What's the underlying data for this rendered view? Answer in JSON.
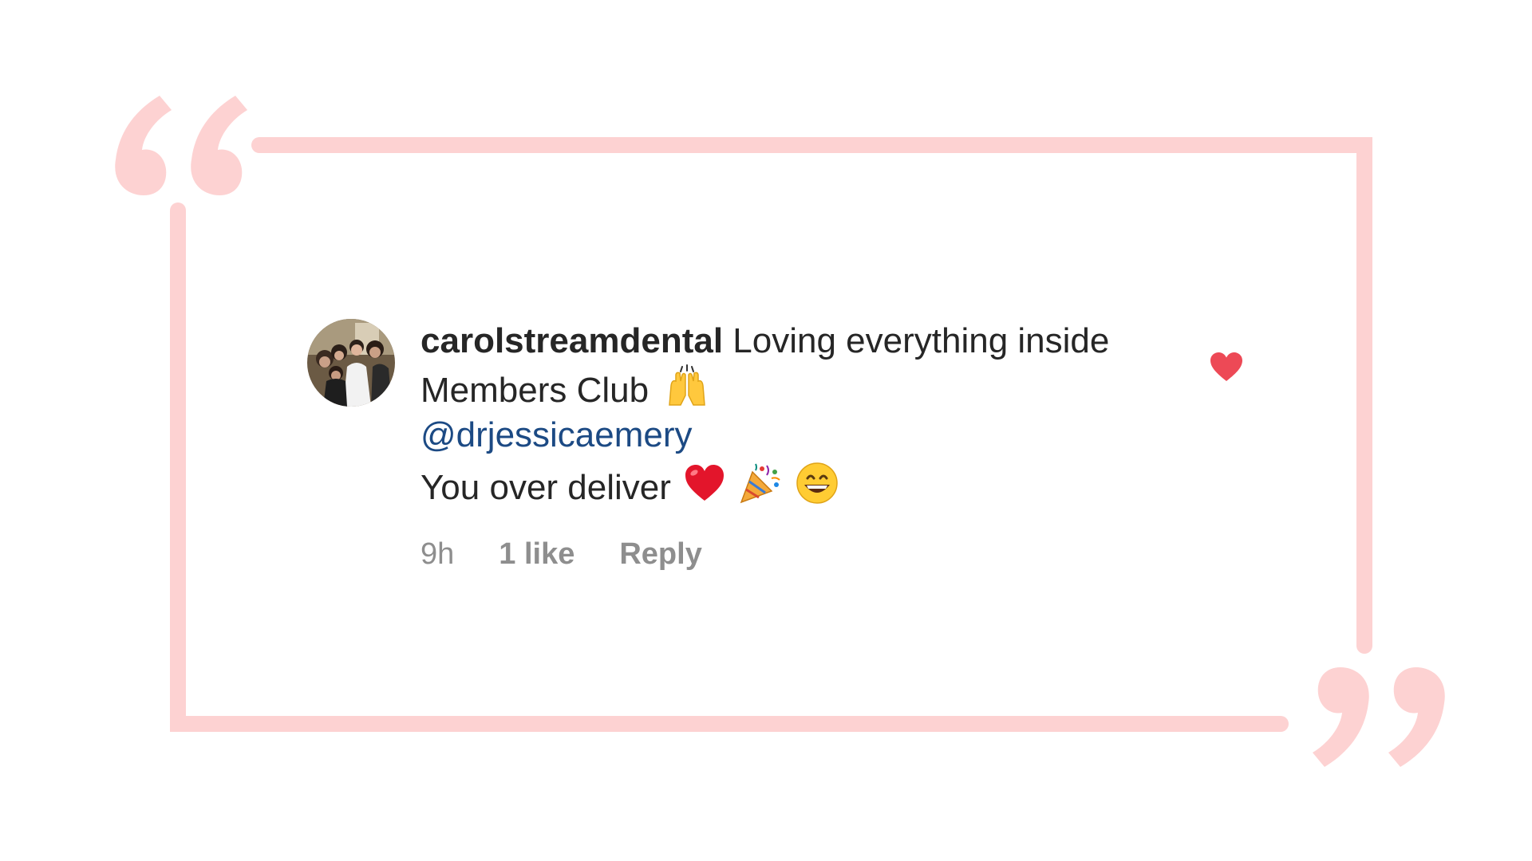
{
  "comment": {
    "username": "carolstreamdental",
    "text_line1": "Loving everything inside Members Club",
    "mention": "@drjessicaemery",
    "text_line2": "You over deliver",
    "time": "9h",
    "likes": "1 like",
    "reply_label": "Reply",
    "liked": true
  },
  "icons": {
    "emoji_after_line1": "raised-hands-icon",
    "emoji_after_line2": [
      "red-heart-icon",
      "party-popper-icon",
      "grinning-face-icon"
    ],
    "like_button": "heart-icon"
  },
  "colors": {
    "frame": "#fdd2d2",
    "like_heart": "#ed4956",
    "mention": "#1c4a84",
    "meta_text": "#8e8e8e"
  }
}
